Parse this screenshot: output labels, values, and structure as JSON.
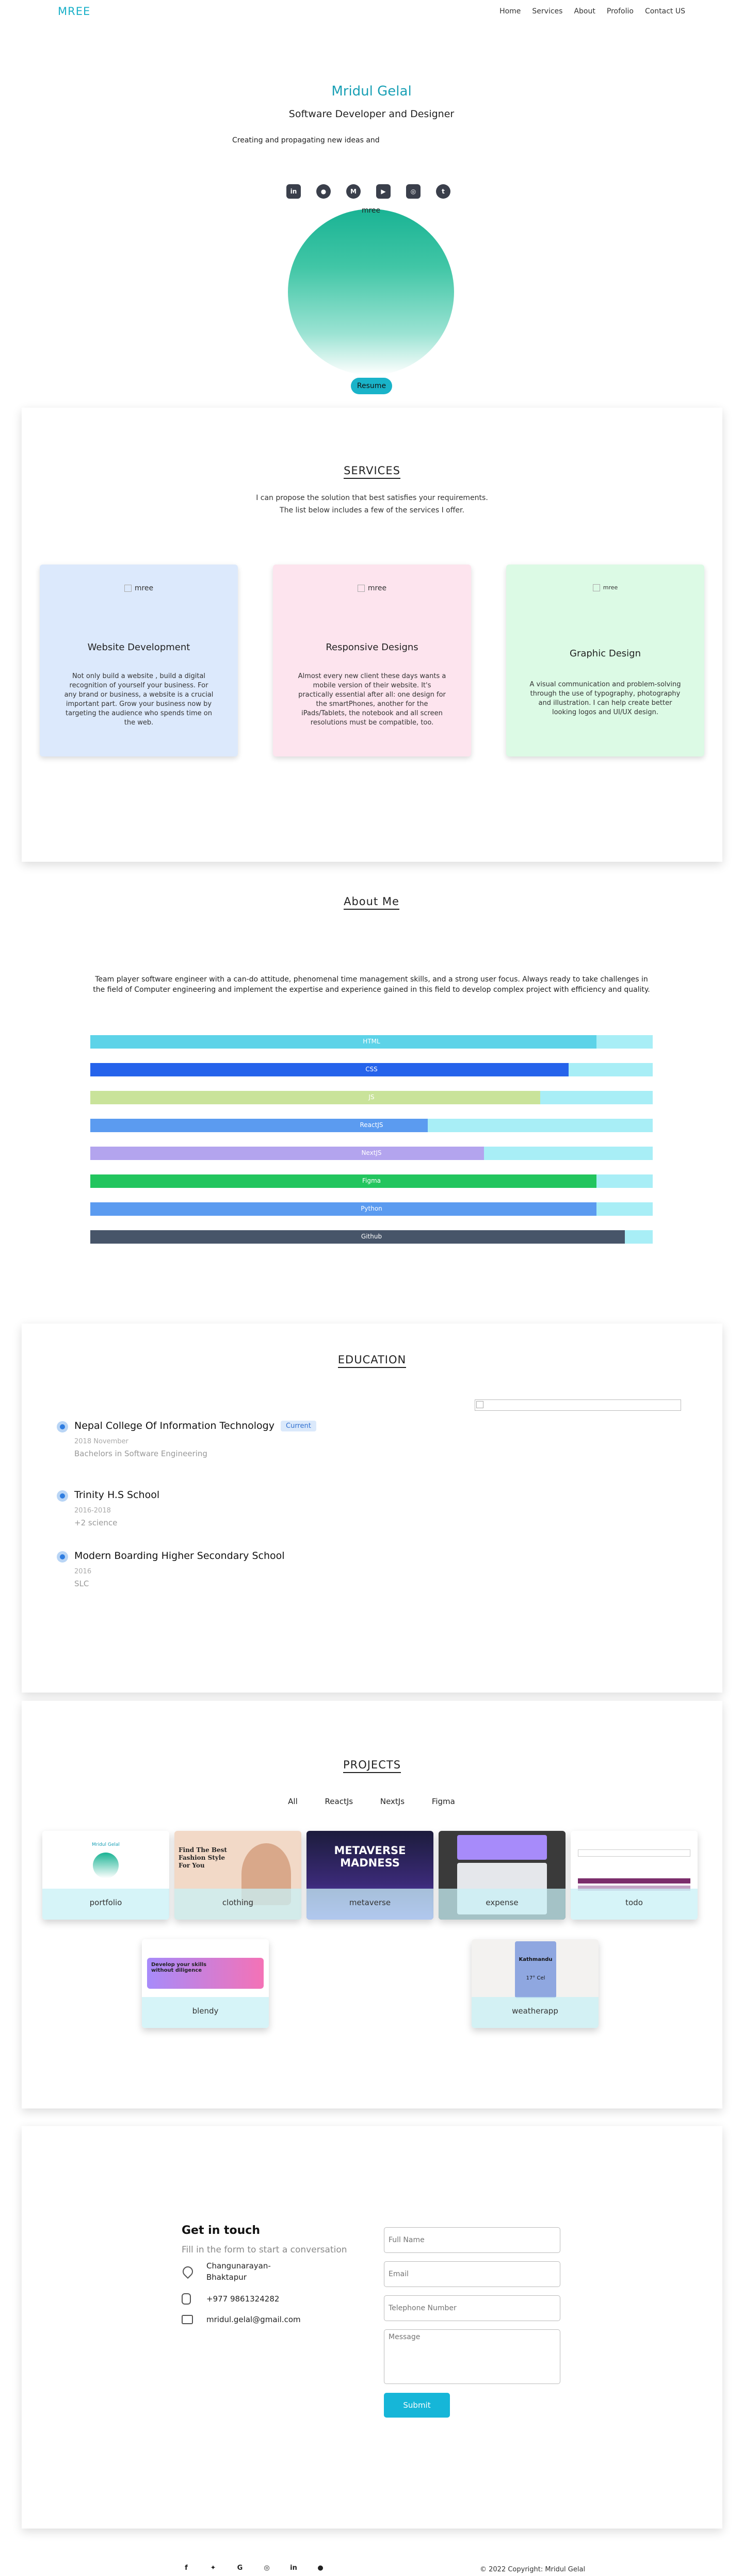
{
  "nav": {
    "logo": "MREE",
    "links": [
      "Home",
      "Services",
      "About",
      "Profolio",
      "Contact US"
    ]
  },
  "hero": {
    "name": "Mridul Gelal",
    "role": "Software Developer and Designer",
    "tagline": "Creating and propagating new ideas and",
    "socials": [
      "linkedin-icon",
      "github-icon",
      "medium-icon",
      "youtube-icon",
      "instagram-icon",
      "twitter-icon"
    ],
    "avatar_alt": "mree",
    "resume_label": "Resume"
  },
  "services": {
    "title": "SERVICES",
    "desc_line1": "I can propose the solution that best satisfies your requirements.",
    "desc_line2": "The list below includes a few of the services I offer.",
    "cards": [
      {
        "img_alt": "mree",
        "title": "Website Development",
        "text": "Not only build a website , build a digital recognition of yourself your business. For any brand or business, a website is a crucial important part. Grow your business now by targeting the audience who spends time on the web.",
        "color": "#dce9fc"
      },
      {
        "img_alt": "mree",
        "title": "Responsive Designs",
        "text": "Almost every new client these days wants a mobile version of their website. It's practically essential after all: one design for the smartPhones, another for the iPads/Tablets, the notebook and all screen resolutions must be compatible, too.",
        "color": "#fde4ee"
      },
      {
        "img_alt": "mree",
        "title": "Graphic Design",
        "text": "A visual communication and problem-solving through the use of typography, photography and illustration. I can help create better looking logos and UI/UX design.",
        "color": "#dcfae5"
      }
    ]
  },
  "about": {
    "title": "About Me",
    "text": "Team player software engineer with a can-do attitude, phenomenal time management skills, and a strong user focus. Always ready to take challenges in the field of Computer engineering and implement the expertise and experience gained in this field to develop complex project with efficiency and quality.",
    "skills": [
      {
        "label": "HTML",
        "percent": 90,
        "color": "#5dd3e8"
      },
      {
        "label": "CSS",
        "percent": 85,
        "color": "#2563eb"
      },
      {
        "label": "JS",
        "percent": 80,
        "color": "#c9e39a"
      },
      {
        "label": "ReactJS",
        "percent": 60,
        "color": "#5b9bf0"
      },
      {
        "label": "NextJS",
        "percent": 70,
        "color": "#b3a4ee"
      },
      {
        "label": "Figma",
        "percent": 90,
        "color": "#22c55e"
      },
      {
        "label": "Python",
        "percent": 90,
        "color": "#5b9bf0"
      },
      {
        "label": "Github",
        "percent": 95,
        "color": "#475569"
      }
    ]
  },
  "education": {
    "title": "EDUCATION",
    "items": [
      {
        "name": "Nepal College Of Information Technology",
        "badge": "Current",
        "date": "2018 November",
        "degree": "Bachelors in Software Engineering"
      },
      {
        "name": "Trinity H.S School",
        "badge": "",
        "date": "2016-2018",
        "degree": "+2 science"
      },
      {
        "name": "Modern Boarding Higher Secondary School",
        "badge": "",
        "date": "2016",
        "degree": "SLC"
      }
    ]
  },
  "projects": {
    "title": "PROJECTS",
    "tabs": [
      "All",
      "ReactJs",
      "NextJs",
      "Figma"
    ],
    "items": [
      {
        "label": "portfolio"
      },
      {
        "label": "clothing"
      },
      {
        "label": "metaverse"
      },
      {
        "label": "expense"
      },
      {
        "label": "todo"
      },
      {
        "label": "blendy"
      },
      {
        "label": "weatherapp"
      }
    ],
    "shot_text": {
      "portfolio": "Mridul Gelal",
      "clothing": "Find The Best Fashion Style For You",
      "metaverse": "METAVERSE MADNESS",
      "blendy": "Develop your skills without diligence",
      "weather_city": "Kathmandu",
      "weather_temp": "17° Cel"
    }
  },
  "contact": {
    "title": "Get in touch",
    "subtitle": "Fill in the form to start a conversation",
    "address_line1": "Changunarayan-",
    "address_line2": "Bhaktapur",
    "phone": "+977 9861324282",
    "email": "mridul.gelal@gmail.com",
    "placeholders": {
      "name": "Full Name",
      "email": "Email",
      "phone": "Telephone Number",
      "message": "Message"
    },
    "submit_label": "Submit"
  },
  "footer": {
    "icons": [
      "facebook-icon",
      "twitter-icon",
      "google-icon",
      "instagram-icon",
      "linkedin-icon",
      "github-icon"
    ],
    "copyright": "© 2022 Copyright:",
    "copyright_name": "Mridul Gelal"
  }
}
